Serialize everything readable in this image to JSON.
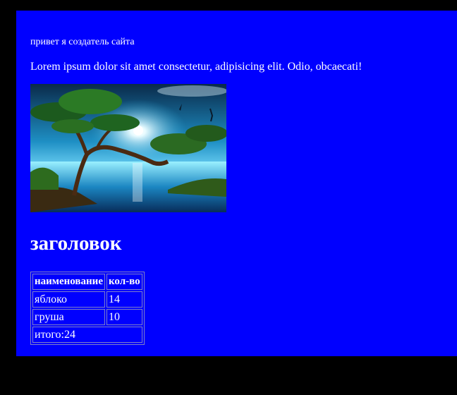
{
  "intro": {
    "greeting": "привет я создатель сайта",
    "paragraph": "Lorem ipsum dolor sit amet consectetur, adipisicing elit. Odio, obcaecati!"
  },
  "hero_image": {
    "alt": "landscape-with-tree-and-moon"
  },
  "heading": "заголовок",
  "table": {
    "headers": [
      "наименование",
      "кол-во"
    ],
    "rows": [
      [
        "яблоко",
        "14"
      ],
      [
        "груша",
        "10"
      ]
    ],
    "total": "итого:24"
  },
  "colors": {
    "background": "#0000ff",
    "frame": "#000000",
    "text": "#ffffff"
  }
}
